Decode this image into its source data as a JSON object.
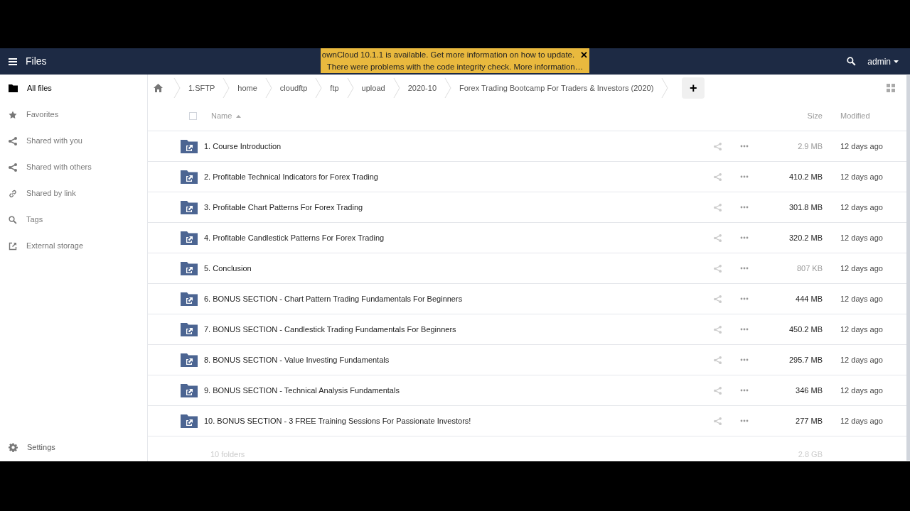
{
  "header": {
    "app_title": "Files",
    "user": "admin"
  },
  "notification": {
    "lines": [
      "ownCloud 10.1.1 is available. Get more information on how to update.",
      "There were problems with the code integrity check. More information…"
    ],
    "close": "✕"
  },
  "sidebar": {
    "items": [
      {
        "label": "All files",
        "kind": "folder",
        "selected": true
      },
      {
        "label": "Favorites",
        "kind": "star",
        "selected": false
      },
      {
        "label": "Shared with you",
        "kind": "share",
        "selected": false
      },
      {
        "label": "Shared with others",
        "kind": "share",
        "selected": false
      },
      {
        "label": "Shared by link",
        "kind": "link",
        "selected": false
      },
      {
        "label": "Tags",
        "kind": "search",
        "selected": false
      },
      {
        "label": "External storage",
        "kind": "external",
        "selected": false
      }
    ],
    "settings": "Settings"
  },
  "breadcrumbs": [
    "1.SFTP",
    "home",
    "cloudftp",
    "ftp",
    "upload",
    "2020-10",
    "Forex Trading Bootcamp For Traders & Investors (2020)"
  ],
  "add_button": "+",
  "table": {
    "select_all_checked": false,
    "columns": [
      "Name",
      "Size",
      "Modified"
    ],
    "rows": [
      {
        "name": "1. Course Introduction",
        "size": "2.9 MB",
        "faded": true,
        "modified": "12 days ago"
      },
      {
        "name": "2. Profitable Technical Indicators for Forex Trading",
        "size": "410.2 MB",
        "faded": false,
        "modified": "12 days ago"
      },
      {
        "name": "3. Profitable Chart Patterns For Forex Trading",
        "size": "301.8 MB",
        "faded": false,
        "modified": "12 days ago"
      },
      {
        "name": "4. Profitable Candlestick Patterns For Forex Trading",
        "size": "320.2 MB",
        "faded": false,
        "modified": "12 days ago"
      },
      {
        "name": "5. Conclusion",
        "size": "807 KB",
        "faded": true,
        "modified": "12 days ago"
      },
      {
        "name": "6. BONUS SECTION - Chart Pattern Trading Fundamentals For Beginners",
        "size": "444 MB",
        "faded": false,
        "modified": "12 days ago"
      },
      {
        "name": "7. BONUS SECTION - Candlestick Trading Fundamentals For Beginners",
        "size": "450.2 MB",
        "faded": false,
        "modified": "12 days ago"
      },
      {
        "name": "8. BONUS SECTION - Value Investing Fundamentals",
        "size": "295.7 MB",
        "faded": false,
        "modified": "12 days ago"
      },
      {
        "name": "9. BONUS SECTION - Technical Analysis Fundamentals",
        "size": "346 MB",
        "faded": false,
        "modified": "12 days ago"
      },
      {
        "name": "10. BONUS SECTION - 3 FREE Training Sessions For Passionate Investors!",
        "size": "277 MB",
        "faded": false,
        "modified": "12 days ago"
      }
    ],
    "summary": {
      "count": "10 folders",
      "size": "2.8 GB"
    }
  }
}
